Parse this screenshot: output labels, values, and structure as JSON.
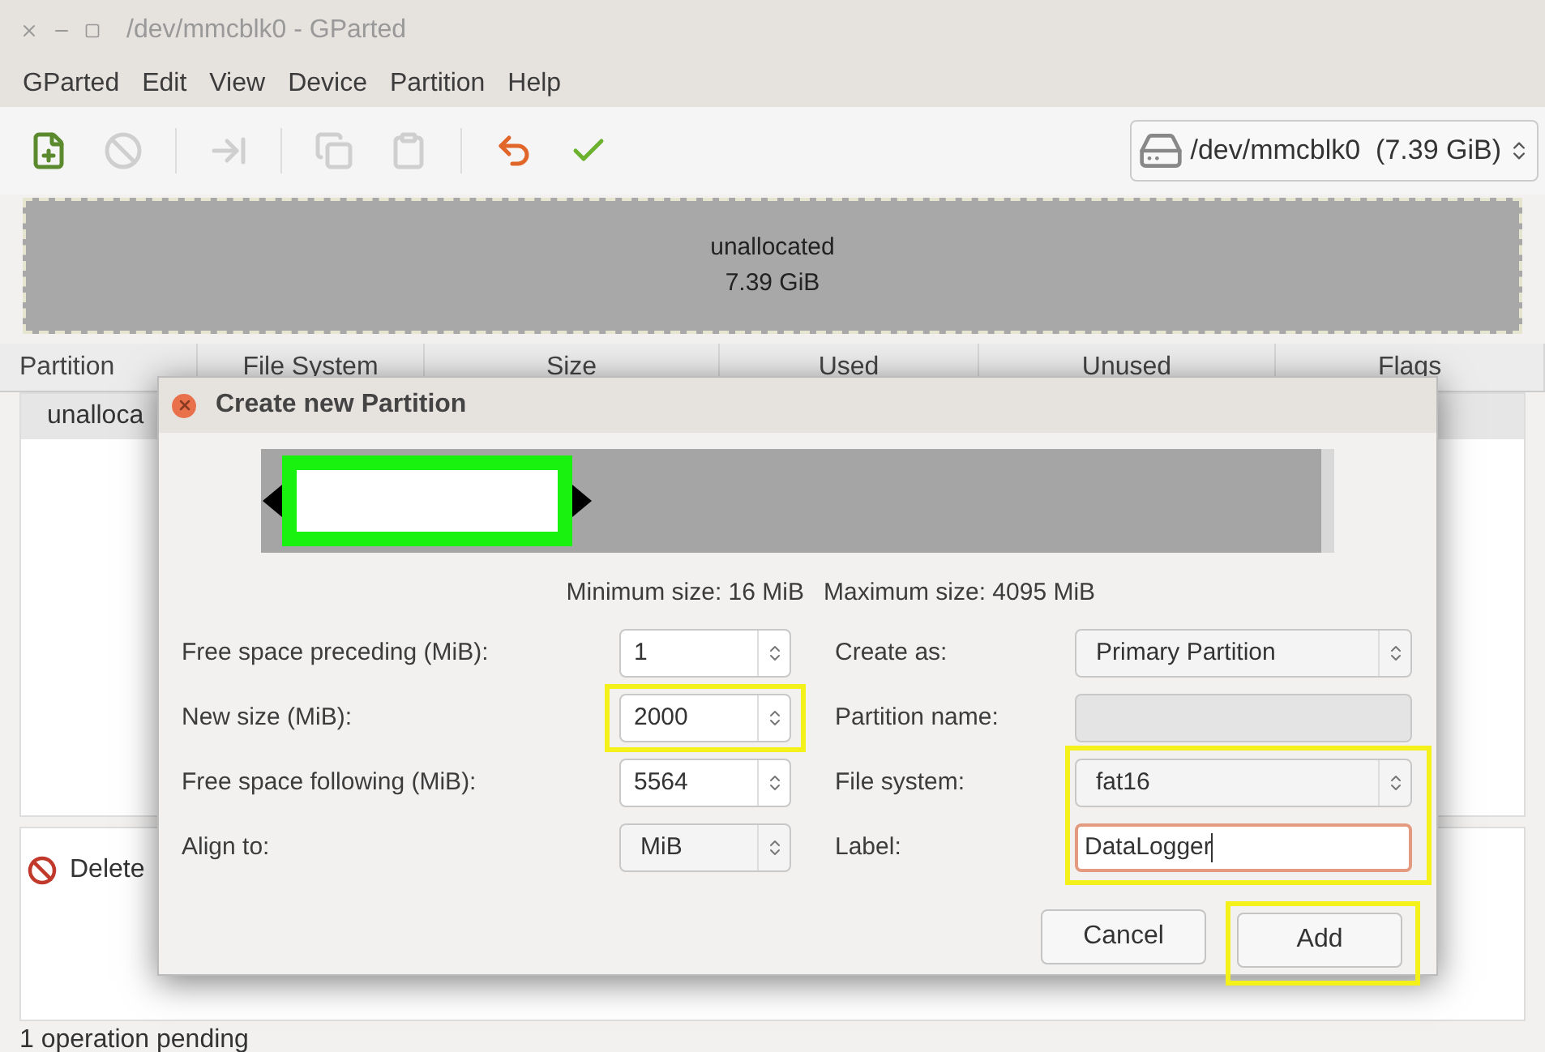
{
  "window": {
    "title": "/dev/mmcblk0 - GParted"
  },
  "menu": [
    "GParted",
    "Edit",
    "View",
    "Device",
    "Partition",
    "Help"
  ],
  "toolbar": {
    "buttons": [
      {
        "kind": "new",
        "disabled": false
      },
      {
        "kind": "delete",
        "disabled": true
      },
      {
        "kind": "resize",
        "disabled": true
      },
      {
        "kind": "copy",
        "disabled": true
      },
      {
        "kind": "paste",
        "disabled": true
      },
      {
        "kind": "undo",
        "disabled": false
      },
      {
        "kind": "apply",
        "disabled": false
      }
    ],
    "device": "/dev/mmcblk0  (7.39 GiB)"
  },
  "disk_map": {
    "label": "unallocated",
    "size": "7.39 GiB"
  },
  "table": {
    "columns": [
      "Partition",
      "File System",
      "Size",
      "Used",
      "Unused",
      "Flags"
    ],
    "rows": [
      {
        "partition": "unalloca"
      }
    ]
  },
  "operations": [
    {
      "text": "Delete"
    }
  ],
  "status_bar": "1 operation pending",
  "dialog": {
    "title": "Create new Partition",
    "resizer": {
      "level": 0.28
    },
    "min_size": "Minimum size: 16 MiB",
    "max_size": "Maximum size: 4095 MiB",
    "left_fields": [
      {
        "label": "Free space preceding (MiB):",
        "value": "1",
        "kind": "spin",
        "highlighted": false
      },
      {
        "label": "New size (MiB):",
        "value": "2000",
        "kind": "spin",
        "highlighted": true
      },
      {
        "label": "Free space following (MiB):",
        "value": "5564",
        "kind": "spin",
        "highlighted": false
      },
      {
        "label": "Align to:",
        "value": "MiB",
        "kind": "combo",
        "highlighted": false
      }
    ],
    "right_fields": [
      {
        "label": "Create as:",
        "value": "Primary Partition",
        "kind": "combo",
        "highlighted": false
      },
      {
        "label": "Partition name:",
        "kind": "text",
        "disabled": true,
        "focused": false,
        "highlighted": false
      },
      {
        "label": "File system:",
        "value": "fat16",
        "kind": "combo",
        "highlighted": true
      },
      {
        "label": "Label:",
        "value": "DataLogger",
        "kind": "text",
        "disabled": false,
        "focused": true,
        "highlighted": true
      }
    ],
    "buttons": [
      {
        "label": "Cancel",
        "highlighted": false
      },
      {
        "label": "Add",
        "highlighted": true
      }
    ]
  }
}
